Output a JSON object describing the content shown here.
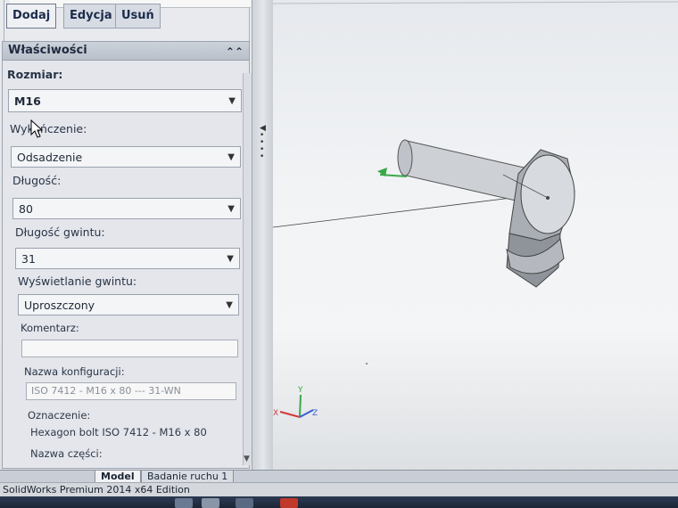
{
  "top_buttons": [
    "Dodaj",
    "Edycja",
    "Usuń"
  ],
  "properties": {
    "title": "Właściwości",
    "size": {
      "label": "Rozmiar:",
      "value": "M16"
    },
    "finish": {
      "label": "Wykończenie:",
      "value": "Odsadzenie"
    },
    "length": {
      "label": "Długość:",
      "value": "80"
    },
    "thread_length": {
      "label": "Długość gwintu:",
      "value": "31"
    },
    "thread_display": {
      "label": "Wyświetlanie gwintu:",
      "value": "Uproszczony"
    },
    "comment": {
      "label": "Komentarz:",
      "value": ""
    },
    "config_name": {
      "label": "Nazwa konfiguracji:",
      "value": "ISO 7412 - M16 x 80 --- 31-WN"
    },
    "designation": {
      "label": "Oznaczenie:",
      "value": "Hexagon bolt ISO 7412 - M16 x 80"
    },
    "part_name": {
      "label": "Nazwa części:"
    }
  },
  "bottom_tabs": [
    "Model",
    "Badanie ruchu 1"
  ],
  "status_bar": "SolidWorks Premium 2014 x64 Edition",
  "colors": {
    "axis_x": "#d23a3a",
    "axis_y": "#3aa84a",
    "axis_z": "#3a5fd2",
    "taskbar": "#1f2a3d"
  }
}
